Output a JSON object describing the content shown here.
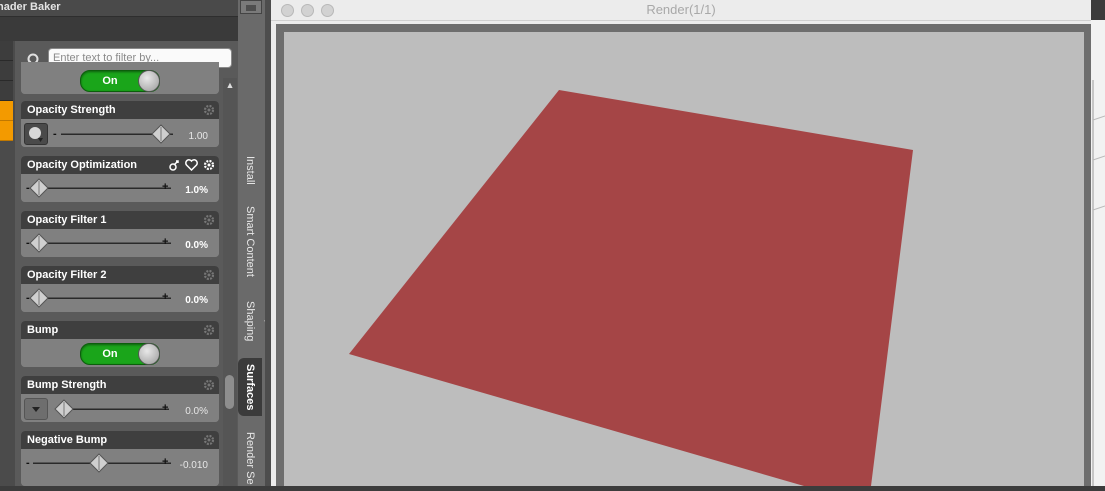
{
  "panel": {
    "title": "hader Baker"
  },
  "filter": {
    "placeholder": "Enter text to filter by..."
  },
  "properties": [
    {
      "title": "Opacity Strength",
      "value": "1.00"
    },
    {
      "title": "Opacity Optimization",
      "value": "1.0%"
    },
    {
      "title": "Opacity Filter 1",
      "value": "0.0%"
    },
    {
      "title": "Opacity Filter 2",
      "value": "0.0%"
    },
    {
      "title": "Bump",
      "toggle": "On"
    },
    {
      "title": "Bump Strength",
      "value": "0.0%"
    },
    {
      "title": "Negative Bump",
      "value": "-0.010"
    }
  ],
  "top_toggle": "On",
  "slider_levels": {
    "opacity_strength": 1.0,
    "opacity_optimization": 0.01,
    "opacity_filter_1": 0.0,
    "opacity_filter_2": 0.0,
    "bump_strength": 0.0,
    "negative_bump_position": 0.5
  },
  "tabs": [
    "Install",
    "Smart Content",
    "Shaping",
    "Surfaces",
    "Render Se"
  ],
  "active_tab": "Surfaces",
  "render_window": {
    "title": "Render(1/1)"
  },
  "colors": {
    "plane": "#a54546",
    "canvas_bg": "#bdbdbd",
    "toggle_on": "#1aa51a",
    "accent_orange": "#f39a00"
  },
  "icons": [
    "search-icon",
    "gear-icon",
    "link-icon",
    "heart-icon",
    "dropdown-arrow-icon",
    "collapse-arrow-icon"
  ]
}
